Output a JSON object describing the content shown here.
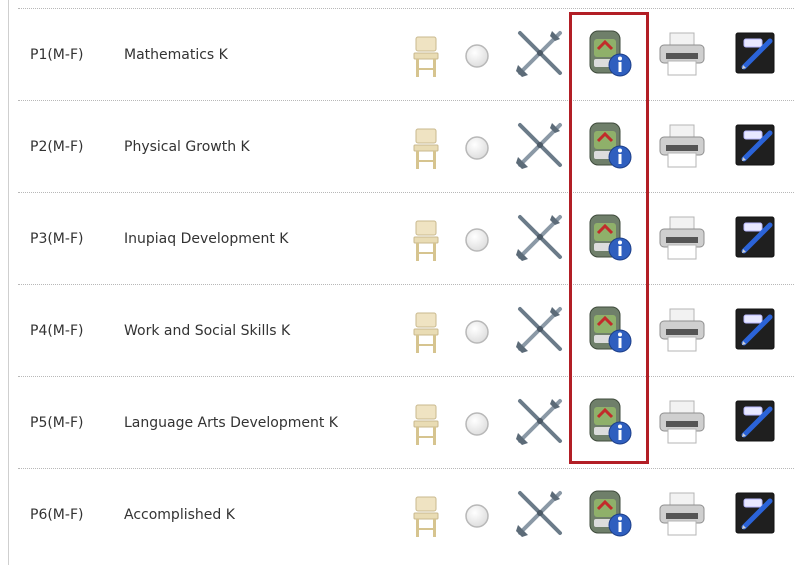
{
  "rows": [
    {
      "period": "P1(M-F)",
      "course": "Mathematics K"
    },
    {
      "period": "P2(M-F)",
      "course": "Physical Growth K"
    },
    {
      "period": "P3(M-F)",
      "course": "Inupiaq Development K"
    },
    {
      "period": "P4(M-F)",
      "course": "Work and Social Skills K"
    },
    {
      "period": "P5(M-F)",
      "course": "Language Arts Development K"
    },
    {
      "period": "P6(M-F)",
      "course": "Accomplished K"
    }
  ],
  "colors": {
    "highlight": "#b21e25",
    "divider": "#b8b8b8"
  },
  "icons": [
    "chair-icon",
    "radio-button",
    "tools-icon",
    "backpack-info-icon",
    "printer-icon",
    "notebook-pen-icon"
  ]
}
